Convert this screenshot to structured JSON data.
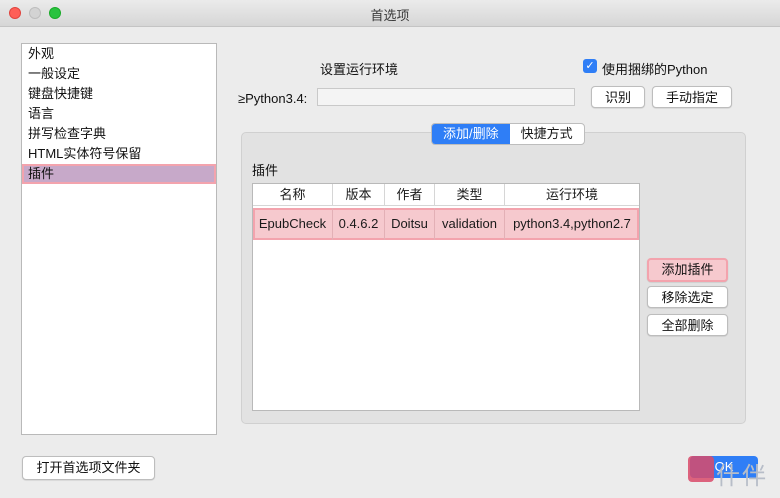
{
  "window": {
    "title": "首选项"
  },
  "sidebar": {
    "items": [
      {
        "label": "外观"
      },
      {
        "label": "一般设定"
      },
      {
        "label": "键盘快捷键"
      },
      {
        "label": "语言"
      },
      {
        "label": "拼写检查字典"
      },
      {
        "label": "HTML实体符号保留"
      },
      {
        "label": "插件",
        "selected": true
      }
    ]
  },
  "env": {
    "heading": "设置运行环境",
    "use_bundled_label": "使用捆绑的Python",
    "use_bundled_checked": true,
    "python_label": "≥Python3.4:",
    "python_value": "",
    "identify_button": "识别",
    "manual_button": "手动指定"
  },
  "tabs": {
    "items": [
      "添加/删除",
      "快捷方式"
    ],
    "active": "添加/删除"
  },
  "plugins": {
    "heading": "插件",
    "columns": [
      "名称",
      "版本",
      "作者",
      "类型",
      "运行环境"
    ],
    "rows": [
      {
        "name": "EpubCheck",
        "version": "0.4.6.2",
        "author": "Doitsu",
        "type": "validation",
        "env": "python3.4,python2.7"
      }
    ]
  },
  "actions": {
    "add": "添加插件",
    "remove": "移除选定",
    "remove_all": "全部删除"
  },
  "footer": {
    "open_folder": "打开首选项文件夹",
    "ok": "OK"
  },
  "watermark": {
    "text": "什伴"
  },
  "colors": {
    "accent": "#2f7ef6",
    "highlight": "#f6c9ce",
    "selection": "#c7a9c9"
  }
}
